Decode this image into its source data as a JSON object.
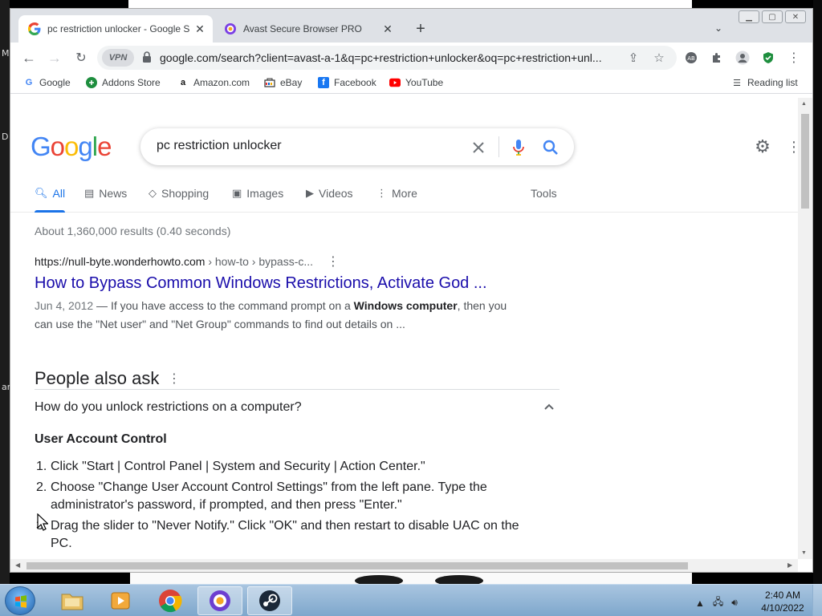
{
  "desktop": {
    "left_letters": [
      "M",
      "D",
      "ar"
    ]
  },
  "browser": {
    "tabs": [
      {
        "title": "pc restriction unlocker - Google S",
        "active": true
      },
      {
        "title": "Avast Secure Browser PRO",
        "active": false
      }
    ],
    "vpn_label": "VPN",
    "url": "google.com/search?client=avast-a-1&q=pc+restriction+unlocker&oq=pc+restriction+unl...",
    "bookmarks": [
      "Google",
      "Addons Store",
      "Amazon.com",
      "eBay",
      "Facebook",
      "YouTube"
    ],
    "reading_list": "Reading list"
  },
  "google": {
    "logo": "Google",
    "query": "pc restriction unlocker",
    "nav_tabs": [
      "All",
      "News",
      "Shopping",
      "Images",
      "Videos",
      "More"
    ],
    "tools": "Tools",
    "stats": "About 1,360,000 results (0.40 seconds)",
    "result": {
      "cite_host": "https://null-byte.wonderhowto.com",
      "cite_path": " › how-to › bypass-c...",
      "title": "How to Bypass Common Windows Restrictions, Activate God ...",
      "date": "Jun 4, 2012",
      "snippet_pre": " — If you have access to the command prompt on a ",
      "snippet_bold": "Windows computer",
      "snippet_post": ", then you can use the \"Net user\" and \"Net Group\" commands to find out details on ..."
    },
    "paa": {
      "heading": "People also ask",
      "question": "How do you unlock restrictions on a computer?",
      "answer_heading": "User Account Control",
      "steps": [
        {
          "num": "1.",
          "text": "Click \"Start | Control Panel | System and Security | Action Center.\""
        },
        {
          "num": "2.",
          "text": "Choose \"Change User Account Control Settings\" from the left pane. Type the administrator's password, if prompted, and then press \"Enter.\""
        },
        {
          "num": "3.",
          "text": "Drag the slider to \"Never Notify.\" Click \"OK\" and then restart to disable UAC on the PC."
        }
      ]
    }
  },
  "taskbar": {
    "time": "2:40 AM",
    "date": "4/10/2022"
  },
  "colors": {
    "link": "#1a0dab",
    "accent": "#1a73e8",
    "taskbar": "#8fb3d6"
  }
}
